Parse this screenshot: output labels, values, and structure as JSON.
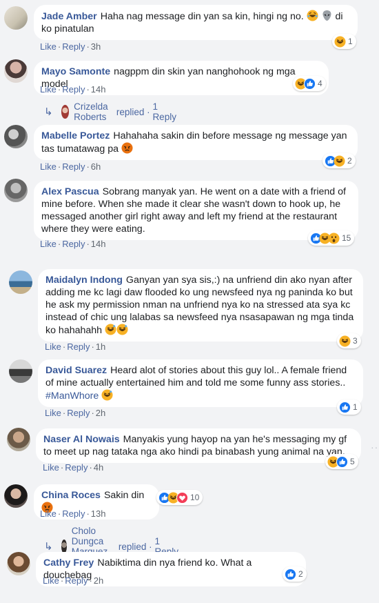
{
  "actions": {
    "like": "Like",
    "reply": "Reply",
    "sep": "·"
  },
  "comments": [
    {
      "name": "Jade Amber",
      "text": "Haha nag message din yan sa kin, hingi ng no.",
      "text2": "di ko pinatulan",
      "time": "3h",
      "reactions": [
        "haha"
      ],
      "count": "1"
    },
    {
      "name": "Mayo Samonte",
      "text": "nagppm din skin yan nanghohook ng mga model",
      "time": "14h",
      "reactions": [
        "haha",
        "like"
      ],
      "count": "4",
      "reply": {
        "name": "Crizelda Roberts",
        "label": "replied",
        "count": "1 Reply"
      }
    },
    {
      "name": "Mabelle Portez",
      "text": "Hahahaha sakin din before message ng message yan tas tumatawag pa",
      "time": "6h",
      "reactions": [
        "like",
        "haha"
      ],
      "count": "2"
    },
    {
      "name": "Alex Pascua",
      "text": "Sobrang manyak yan. He went on a date with a friend of mine before. When she made it clear she wasn't down to hook up, he messaged another girl right away and left my friend at the restaurant where they were eating.",
      "time": "14h",
      "reactions": [
        "like",
        "haha",
        "wow"
      ],
      "count": "15"
    },
    {
      "name": "Maidalyn Indong",
      "text": "Ganyan yan sya sis,:) na unfriend din ako nyan after adding me kc lagi daw flooded ko ung newsfeed nya ng paninda ko but he ask my permission nman na unfriend nya ko na stressed ata sya kc instead of chic ung lalabas sa newsfeed nya nsasapawan ng mga tinda ko hahahahh",
      "time": "1h",
      "reactions": [
        "haha"
      ],
      "count": "3"
    },
    {
      "name": "David Suarez",
      "text": "Heard alot of stories about this guy lol.. A female friend of mine actually entertained him and told me some funny ass stories..",
      "tag": "#ManWhore",
      "time": "2h",
      "reactions": [
        "like"
      ],
      "count": "1"
    },
    {
      "name": "Naser Al Nowais",
      "text": "Manyakis yung hayop na yan he's messaging my gf to meet up nag tataka nga ako hindi pa binabash yung animal na yan.",
      "time": "4h",
      "reactions": [
        "haha",
        "like"
      ],
      "count": "5"
    },
    {
      "name": "China Roces",
      "text": "Sakin din",
      "time": "13h",
      "reactions": [
        "like",
        "haha",
        "love"
      ],
      "count": "10",
      "reply": {
        "name": "Cholo Dungca Marquez III",
        "label": "replied",
        "count": "1 Reply"
      }
    },
    {
      "name": "Cathy Frey",
      "text": "Nabiktima din nya friend ko. What a douchebag",
      "time": "2h",
      "reactions": [
        "like"
      ],
      "count": "2"
    }
  ],
  "side_marker": "···",
  "colors": {
    "name": "#385898",
    "action": "#4b67a1",
    "bubble": "#ffffff",
    "bg": "#f2f3f5",
    "like": "#1877f2",
    "haha": "#f7b125",
    "love": "#f33e58",
    "angry": "#e9710f"
  },
  "icons": {
    "reply_arrow": "reply-arrow-icon",
    "laugh": "laughing-emoji",
    "alien": "alien-emoji",
    "angry": "angry-emoji",
    "grin_sweat": "grinning-sweat-emoji"
  }
}
